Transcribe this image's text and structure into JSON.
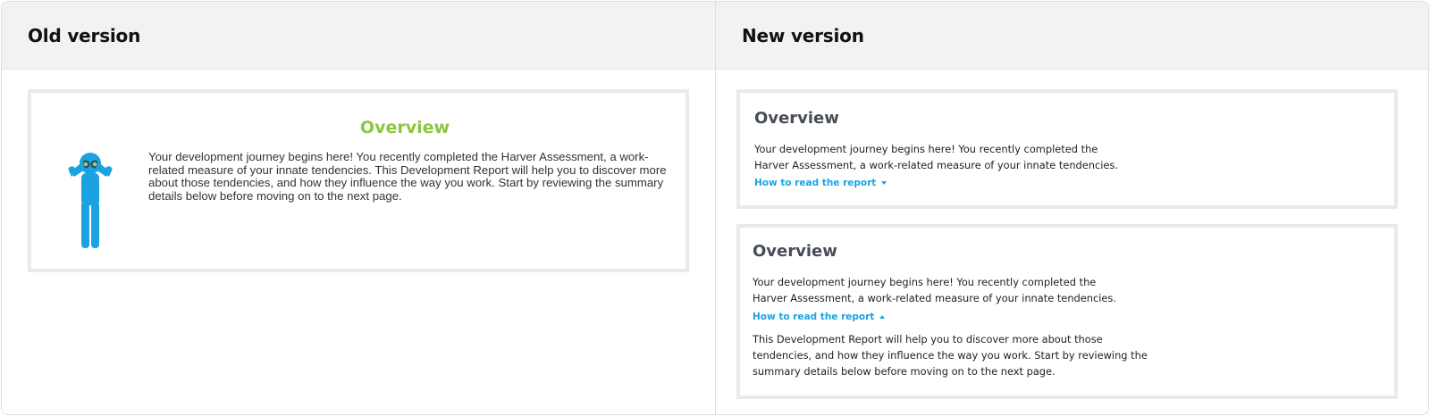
{
  "old_column": {
    "heading": "Old version",
    "card": {
      "title": "Overview",
      "body": "Your development journey begins here! You recently completed the Harver Assessment, a work-related measure of your innate tendencies. This Development Report will help you to discover more about those tendencies, and how they influence the way you work. Start by reviewing the summary details below before moving on to the next page.",
      "illustration_icon": "person-with-binoculars-icon"
    }
  },
  "new_column": {
    "heading": "New version",
    "collapsed_card": {
      "title": "Overview",
      "body": "Your development journey begins here! You recently completed the Harver Assessment, a work-related measure of your innate tendencies.",
      "link_label": "How to read the report",
      "link_icon": "caret-down-icon"
    },
    "expanded_card": {
      "title": "Overview",
      "body": "Your development journey begins here! You recently completed the Harver Assessment, a work-related measure of your innate tendencies.",
      "link_label": "How to read the report",
      "link_icon": "caret-up-icon",
      "expanded_text": "This Development Report will help you to discover more about those tendencies, and how they influence the way you work. Start by reviewing the summary details below before moving on to the next page."
    }
  },
  "colors": {
    "old_title": "#8cc63f",
    "new_title": "#474d54",
    "link": "#1aa3e0",
    "figure": "#1aa3e0",
    "header_bg": "#f1f3f2",
    "card_border": "#eaeaea"
  }
}
